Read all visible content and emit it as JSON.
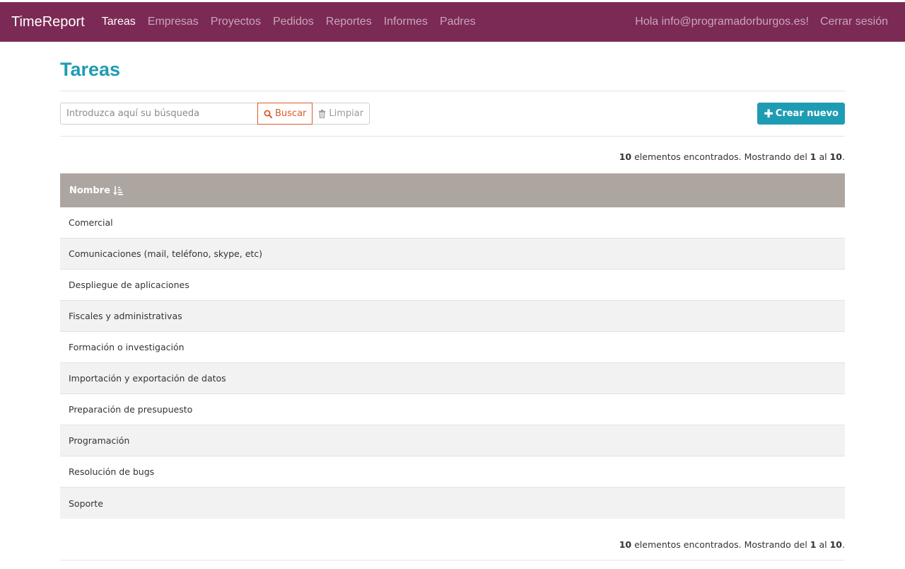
{
  "nav": {
    "brand": "TimeReport",
    "items": [
      {
        "label": "Tareas",
        "active": true
      },
      {
        "label": "Empresas",
        "active": false
      },
      {
        "label": "Proyectos",
        "active": false
      },
      {
        "label": "Pedidos",
        "active": false
      },
      {
        "label": "Reportes",
        "active": false
      },
      {
        "label": "Informes",
        "active": false
      },
      {
        "label": "Padres",
        "active": false
      }
    ],
    "greeting": "Hola info@programadorburgos.es!",
    "logout": "Cerrar sesión"
  },
  "page": {
    "title": "Tareas"
  },
  "search": {
    "placeholder": "Introduzca aquí su búsqueda",
    "value": "",
    "search_label": "Buscar",
    "clear_label": "Limpiar"
  },
  "actions": {
    "create_label": "Crear nuevo"
  },
  "summary": {
    "total": "10",
    "text_found": "elementos encontrados. Mostrando del",
    "from": "1",
    "text_to": "al",
    "to": "10",
    "end": "."
  },
  "table": {
    "column_header": "Nombre",
    "rows": [
      "Comercial",
      "Comunicaciones (mail, teléfono, skype, etc)",
      "Despliegue de aplicaciones",
      "Fiscales y administrativas",
      "Formación o investigación",
      "Importación y exportación de datos",
      "Preparación de presupuesto",
      "Programación",
      "Resolución de bugs",
      "Soporte"
    ]
  },
  "icons": {
    "search": "search-icon",
    "clear": "trash-icon",
    "create": "plus-icon",
    "sort": "sort-alpha-icon"
  },
  "colors": {
    "navbar": "#7b2a55",
    "accent": "#1e9cb4",
    "search_button": "#d95b2a",
    "table_header": "#ada6a0"
  }
}
